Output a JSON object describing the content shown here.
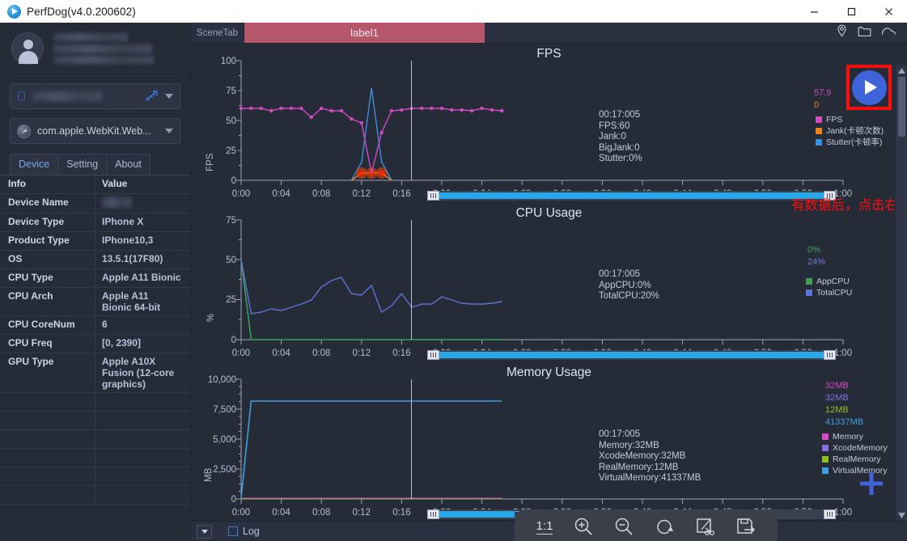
{
  "window": {
    "title": "PerfDog(v4.0.200602)",
    "logo_icon": "perfdog-logo-icon",
    "minimize_label": "—",
    "maximize_label": "□",
    "close_label": "✕"
  },
  "sidebar": {
    "profile": {
      "avatar_icon": "user-avatar-icon",
      "name_redacted": true
    },
    "device_selector": {
      "platform_icon": "apple-icon",
      "value": "",
      "connection_icon": "usb-icon",
      "caret_icon": "chevron-down-icon"
    },
    "app_selector": {
      "app_icon": "safari-icon",
      "value": "com.apple.WebKit.Web...",
      "caret_icon": "chevron-down-icon"
    },
    "tabs": [
      {
        "label": "Device",
        "active": true
      },
      {
        "label": "Setting",
        "active": false
      },
      {
        "label": "About",
        "active": false
      }
    ],
    "table": {
      "headers": [
        "Info",
        "Value"
      ],
      "rows": [
        {
          "key": "Device Name",
          "value": "",
          "redacted": true
        },
        {
          "key": "Device Type",
          "value": "IPhone X"
        },
        {
          "key": "Product Type",
          "value": "IPhone10,3"
        },
        {
          "key": "OS",
          "value": "13.5.1(17F80)"
        },
        {
          "key": "CPU Type",
          "value": "Apple A11 Bionic"
        },
        {
          "key": "CPU Arch",
          "value": "Apple A11 Bionic 64-bit"
        },
        {
          "key": "CPU CoreNum",
          "value": "6"
        },
        {
          "key": "CPU Freq",
          "value": "[0, 2390]"
        },
        {
          "key": "GPU Type",
          "value": "Apple A10X Fusion (12-core graphics)"
        },
        {
          "key": "",
          "value": ""
        },
        {
          "key": "",
          "value": ""
        },
        {
          "key": "",
          "value": ""
        },
        {
          "key": "",
          "value": ""
        },
        {
          "key": "",
          "value": ""
        },
        {
          "key": "",
          "value": ""
        }
      ]
    }
  },
  "scenebar": {
    "scene_tab_label": "SceneTab",
    "active_tab": "label1",
    "icons": [
      "location-pin-icon",
      "folder-icon",
      "cloud-icon"
    ]
  },
  "annotation": {
    "text": "有数据后，点击右上方开始测试",
    "color": "#ff0d0d",
    "arrow_icon": "red-arrow-icon"
  },
  "play_button": {
    "icon": "play-icon",
    "highlight_color": "#ff0d0d",
    "button_color": "#3f63d8"
  },
  "add_button": {
    "icon": "plus-icon",
    "color": "#3f63d8"
  },
  "bottom": {
    "log_dropdown_icon": "chevron-down-icon",
    "log_checkbox_checked": false,
    "log_label": "Log",
    "toolbar": [
      {
        "name": "ratio-1-1",
        "label": "1:1"
      },
      {
        "name": "zoom-in",
        "label": ""
      },
      {
        "name": "zoom-out",
        "label": ""
      },
      {
        "name": "reset-rotate",
        "label": ""
      },
      {
        "name": "crop-cut",
        "label": ""
      },
      {
        "name": "save-export",
        "label": ""
      }
    ]
  },
  "chart_data": [
    {
      "type": "line",
      "title": "FPS",
      "ylabel": "FPS",
      "xlabel": "",
      "ylim": [
        0,
        100
      ],
      "yticks": [
        "0",
        "25",
        "50",
        "75",
        "100"
      ],
      "xticks": [
        "0:00",
        "0:04",
        "0:08",
        "0:12",
        "0:16",
        "0:20",
        "0:24",
        "0:28",
        "0:32",
        "0:36",
        "0:40",
        "0:44",
        "0:48",
        "0:52",
        "0:56",
        "1:00"
      ],
      "grid": false,
      "legend_position": "right",
      "cursor": {
        "time": "00:17:005",
        "lines": [
          "00:17:005",
          "FPS:60",
          "Jank:0",
          "BigJank:0",
          "Stutter:0%"
        ]
      },
      "current_values": [
        {
          "value": "57.9",
          "color": "#d24bc0"
        },
        {
          "value": "0",
          "color": "#e8821e"
        }
      ],
      "series": [
        {
          "name": "FPS",
          "color": "#d24bc0",
          "x": [
            0,
            1,
            2,
            3,
            4,
            5,
            6,
            7,
            8,
            9,
            10,
            11,
            12,
            13,
            14,
            15,
            16,
            17,
            18,
            19,
            20,
            21,
            22,
            23,
            24,
            25,
            26
          ],
          "values": [
            60,
            60,
            60,
            58,
            60,
            60,
            60,
            53,
            60,
            58,
            58,
            51,
            48,
            7,
            40,
            58,
            59,
            60,
            60,
            60,
            60,
            59,
            59,
            58,
            60,
            59,
            58
          ]
        },
        {
          "name": "Jank(卡顿次数)",
          "color": "#e8821e",
          "x": [
            11,
            12,
            13,
            14,
            15
          ],
          "values": [
            0,
            6,
            6,
            6,
            0
          ]
        },
        {
          "name": "Stutter(卡顿率)",
          "color": "#3e8ee0",
          "x": [
            11,
            12,
            13,
            14,
            15
          ],
          "values": [
            0,
            17,
            77,
            18,
            0
          ]
        }
      ]
    },
    {
      "type": "line",
      "title": "CPU Usage",
      "ylabel": "%",
      "xlabel": "",
      "ylim": [
        0,
        75
      ],
      "yticks": [
        "0",
        "25",
        "50",
        "75"
      ],
      "xticks": [
        "0:00",
        "0:04",
        "0:08",
        "0:12",
        "0:16",
        "0:20",
        "0:24",
        "0:28",
        "0:32",
        "0:36",
        "0:40",
        "0:44",
        "0:48",
        "0:52",
        "0:56",
        "1:00"
      ],
      "grid": false,
      "legend_position": "right",
      "cursor": {
        "time": "00:17:005",
        "lines": [
          "00:17:005",
          "AppCPU:0%",
          "TotalCPU:20%"
        ]
      },
      "current_values": [
        {
          "value": "0%",
          "color": "#3fa05a"
        },
        {
          "value": "24%",
          "color": "#6d80dd"
        }
      ],
      "series": [
        {
          "name": "AppCPU",
          "color": "#3fa05a",
          "x": [
            0,
            1,
            2,
            3,
            4,
            5,
            6,
            7,
            8,
            9,
            10,
            11,
            12,
            13,
            14,
            15,
            16,
            17,
            18,
            19,
            20,
            21,
            22,
            23,
            24,
            25,
            26
          ],
          "values": [
            50,
            0,
            0,
            0,
            0,
            0,
            0,
            0,
            0,
            0,
            0,
            0,
            0,
            0,
            0,
            0,
            0,
            0,
            0,
            0,
            0,
            0,
            0,
            0,
            0,
            0,
            0
          ]
        },
        {
          "name": "TotalCPU",
          "color": "#5f72d6",
          "x": [
            0,
            1,
            2,
            3,
            4,
            5,
            6,
            7,
            8,
            9,
            10,
            11,
            12,
            13,
            14,
            15,
            16,
            17,
            18,
            19,
            20,
            21,
            22,
            23,
            24,
            25,
            26
          ],
          "values": [
            50,
            16,
            17,
            19,
            18,
            20,
            22,
            25,
            33,
            37,
            39,
            29,
            28,
            34,
            17,
            21,
            29,
            20,
            22,
            22,
            27,
            25,
            23,
            22,
            22,
            23,
            24
          ]
        }
      ]
    },
    {
      "type": "line",
      "title": "Memory Usage",
      "ylabel": "MB",
      "xlabel": "",
      "ylim": [
        0,
        10000
      ],
      "yticks": [
        "0",
        "2,500",
        "5,000",
        "7,500",
        "10,000"
      ],
      "xticks": [
        "0:00",
        "0:04",
        "0:08",
        "0:12",
        "0:16",
        "0:20",
        "0:24",
        "0:28",
        "0:32",
        "0:36",
        "0:40",
        "0:44",
        "0:48",
        "0:52",
        "0:56",
        "1:00"
      ],
      "grid": false,
      "legend_position": "right",
      "cursor": {
        "time": "00:17:005",
        "lines": [
          "00:17:005",
          "Memory:32MB",
          "XcodeMemory:32MB",
          "RealMemory:12MB",
          "VirtualMemory:41337MB"
        ]
      },
      "current_values": [
        {
          "value": "32MB",
          "color": "#d24bc0"
        },
        {
          "value": "32MB",
          "color": "#8a6ee0"
        },
        {
          "value": "12MB",
          "color": "#8fc322"
        },
        {
          "value": "41337MB",
          "color": "#3e9ee0"
        }
      ],
      "series": [
        {
          "name": "Memory",
          "color": "#d24bc0",
          "x": [
            0,
            26
          ],
          "values": [
            32,
            32
          ]
        },
        {
          "name": "XcodeMemory",
          "color": "#8a6ee0",
          "x": [
            0,
            26
          ],
          "values": [
            32,
            32
          ]
        },
        {
          "name": "RealMemory",
          "color": "#8fc322",
          "x": [
            0,
            26
          ],
          "values": [
            12,
            12
          ]
        },
        {
          "name": "VirtualMemory",
          "color": "#3e9ee0",
          "x": [
            0,
            1,
            26
          ],
          "values": [
            60,
            8200,
            8200
          ]
        }
      ]
    }
  ]
}
